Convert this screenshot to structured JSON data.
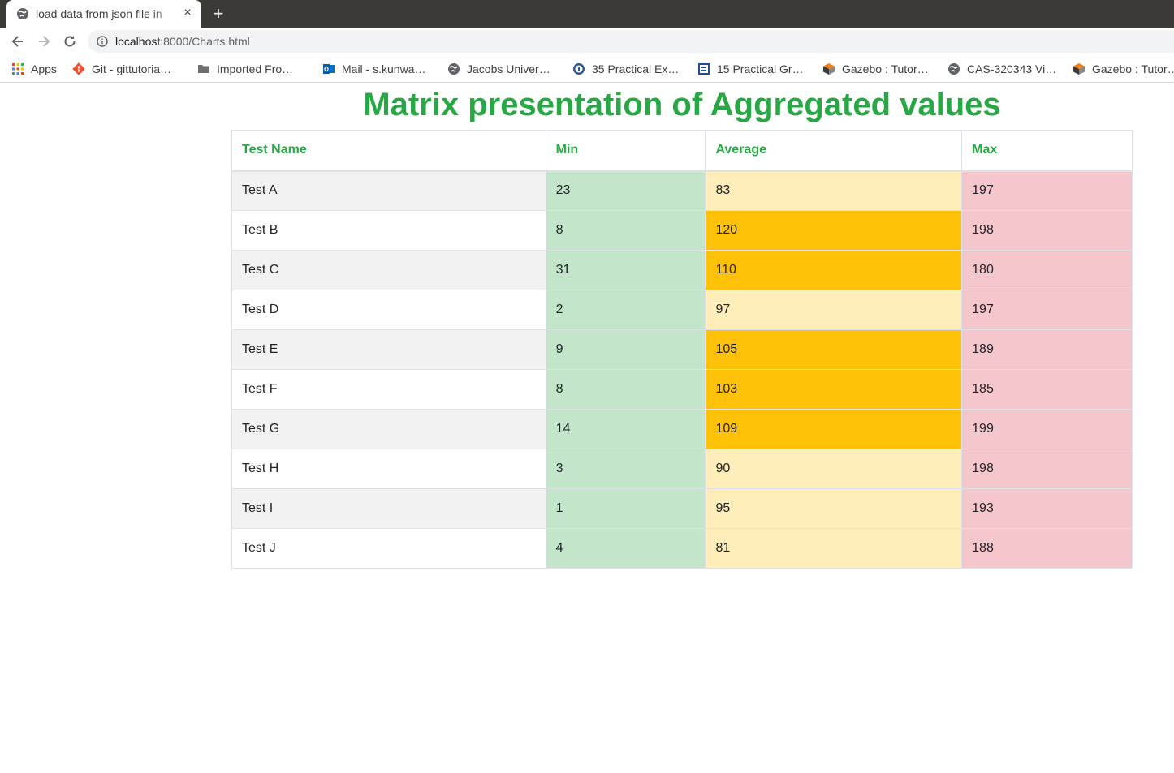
{
  "browser": {
    "tab_title": "load data from json file in",
    "tab_close": "×",
    "new_tab": "+",
    "url_host": "localhost",
    "url_path": ":8000/Charts.html"
  },
  "bookmarks": [
    {
      "label": "Apps",
      "icon": "apps-grid-icon"
    },
    {
      "label": "Git - gittutoria…",
      "icon": "git-icon"
    },
    {
      "label": "Imported Fro…",
      "icon": "folder-icon"
    },
    {
      "label": "Mail - s.kunwa…",
      "icon": "outlook-icon"
    },
    {
      "label": "Jacobs Univer…",
      "icon": "globe-icon"
    },
    {
      "label": "35 Practical Ex…",
      "icon": "site-icon"
    },
    {
      "label": "15 Practical Gr…",
      "icon": "site-icon"
    },
    {
      "label": "Gazebo : Tutor…",
      "icon": "gazebo-icon"
    },
    {
      "label": "CAS-320343 Vi…",
      "icon": "globe-icon"
    },
    {
      "label": "Gazebo : Tutor…",
      "icon": "gazebo-icon"
    }
  ],
  "page": {
    "title": "Matrix presentation of Aggregated values"
  },
  "table": {
    "headers": [
      "Test Name",
      "Min",
      "Average",
      "Max"
    ],
    "rows": [
      {
        "name": "Test A",
        "min": "23",
        "avg": "83",
        "max": "197",
        "avg_level": "light"
      },
      {
        "name": "Test B",
        "min": "8",
        "avg": "120",
        "max": "198",
        "avg_level": "strong"
      },
      {
        "name": "Test C",
        "min": "31",
        "avg": "110",
        "max": "180",
        "avg_level": "strong"
      },
      {
        "name": "Test D",
        "min": "2",
        "avg": "97",
        "max": "197",
        "avg_level": "light"
      },
      {
        "name": "Test E",
        "min": "9",
        "avg": "105",
        "max": "189",
        "avg_level": "strong"
      },
      {
        "name": "Test F",
        "min": "8",
        "avg": "103",
        "max": "185",
        "avg_level": "strong"
      },
      {
        "name": "Test G",
        "min": "14",
        "avg": "109",
        "max": "199",
        "avg_level": "strong"
      },
      {
        "name": "Test H",
        "min": "3",
        "avg": "90",
        "max": "198",
        "avg_level": "light"
      },
      {
        "name": "Test I",
        "min": "1",
        "avg": "95",
        "max": "193",
        "avg_level": "light"
      },
      {
        "name": "Test J",
        "min": "4",
        "avg": "81",
        "max": "188",
        "avg_level": "light"
      }
    ]
  },
  "colors": {
    "title_green": "#28a745",
    "min_cell": "#c3e6cb",
    "avg_light": "#ffeeba",
    "avg_strong": "#ffc107",
    "max_cell": "#f5c6cb"
  }
}
